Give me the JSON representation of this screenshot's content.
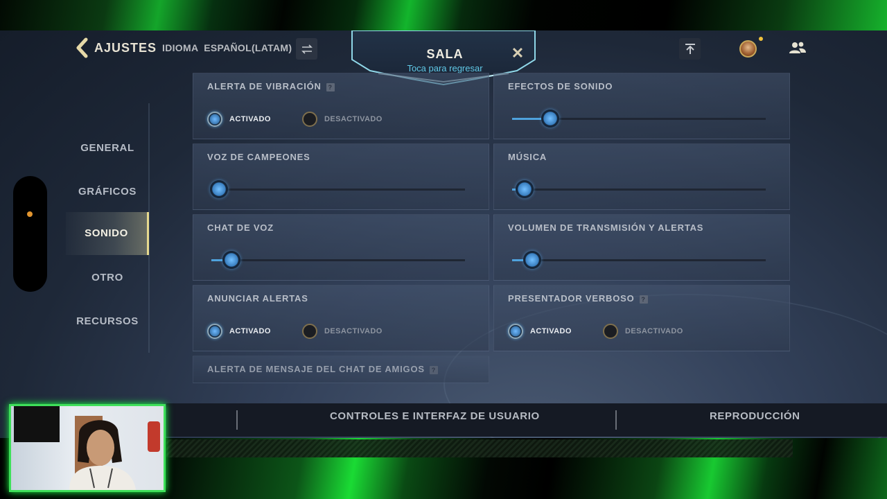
{
  "header": {
    "back_title": "AJUSTES",
    "language_label": "IDIOMA  ESPAÑOL(LATAM)",
    "lobby_title": "SALA",
    "lobby_subtitle": "Toca para regresar"
  },
  "nav": {
    "items": [
      {
        "label": "GENERAL",
        "active": false
      },
      {
        "label": "GRÁFICOS",
        "active": false
      },
      {
        "label": "SONIDO",
        "active": true
      },
      {
        "label": "OTRO",
        "active": false
      },
      {
        "label": "RECURSOS",
        "active": false
      }
    ]
  },
  "settings": {
    "vibration_alert": {
      "title": "ALERTA DE VIBRACIÓN",
      "on_label": "ACTIVADO",
      "off_label": "DESACTIVADO",
      "value": "on",
      "has_help": true
    },
    "sound_effects": {
      "title": "EFECTOS DE SONIDO",
      "value": 0.15
    },
    "champion_voice": {
      "title": "VOZ DE CAMPEONES",
      "value": 0.03
    },
    "music": {
      "title": "MÚSICA",
      "value": 0.05
    },
    "voice_chat": {
      "title": "CHAT DE VOZ",
      "value": 0.08
    },
    "stream_volume": {
      "title": "VOLUMEN DE TRANSMISIÓN Y ALERTAS",
      "value": 0.08
    },
    "announce_alerts": {
      "title": "ANUNCIAR ALERTAS",
      "on_label": "ACTIVADO",
      "off_label": "DESACTIVADO",
      "value": "on"
    },
    "verbose_announcer": {
      "title": "PRESENTADOR VERBOSO",
      "on_label": "ACTIVADO",
      "off_label": "DESACTIVADO",
      "value": "on",
      "has_help": true
    },
    "friend_chat_alert": {
      "title": "ALERTA DE MENSAJE DEL CHAT DE AMIGOS",
      "has_help": true
    }
  },
  "bottom_tabs": {
    "controls": "CONTROLES E INTERFAZ DE USUARIO",
    "replay": "REPRODUCCIÓN"
  },
  "colors": {
    "accent_blue": "#4fa2dd",
    "active_gold": "#e6d98e",
    "frame_green": "#3fe05a"
  },
  "icons": [
    "back-chevron-icon",
    "swap-arrows-icon",
    "close-icon",
    "upload-icon",
    "avatar",
    "friends-icon",
    "help-icon"
  ]
}
